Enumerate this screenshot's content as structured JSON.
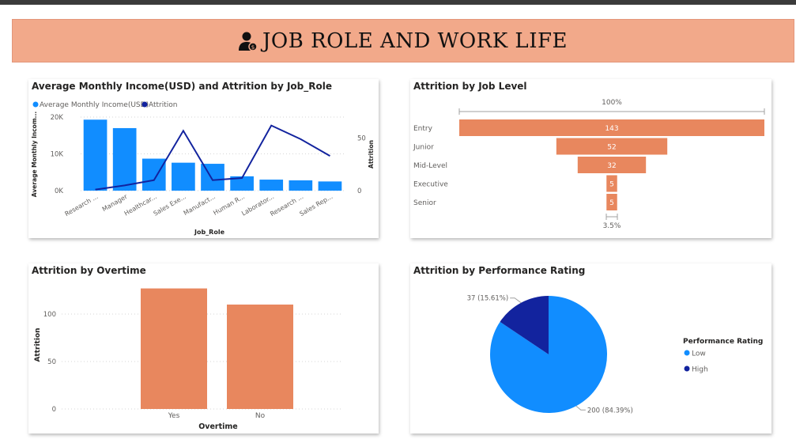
{
  "banner": {
    "title": "JOB ROLE AND WORK LIFE",
    "icon": "person-money-icon"
  },
  "colors": {
    "blue": "#118dff",
    "navy": "#12239e",
    "orange": "#e8875e",
    "banner": "#f2a98a"
  },
  "charts": {
    "income": {
      "title": "Average Monthly Income(USD) and Attrition by Job_Role",
      "legend": [
        "Average Monthly Income(USD)",
        "Attrition"
      ],
      "ylabel": "Average Monthly Incom...",
      "y2label": "Attrition",
      "xlabel": "Job_Role",
      "yticks": [
        "0K",
        "10K",
        "20K"
      ],
      "y2ticks": [
        "0",
        "50"
      ],
      "categories": [
        "Research ...",
        "Manager",
        "Healthcar...",
        "Sales Exe...",
        "Manufact...",
        "Human R...",
        "Laborator...",
        "Research ...",
        "Sales Rep..."
      ]
    },
    "joblevel": {
      "title": "Attrition by Job Level",
      "top_label": "100%",
      "bottom_label": "3.5%"
    },
    "overtime": {
      "title": "Attrition by Overtime",
      "ylabel": "Attrition",
      "xlabel": "Overtime",
      "yticks": [
        "0",
        "50",
        "100"
      ]
    },
    "performance": {
      "title": "Attrition by Performance Rating",
      "legend_title": "Performance Rating",
      "legend": [
        "Low",
        "High"
      ]
    }
  },
  "chart_data": [
    {
      "type": "bar",
      "title": "Average Monthly Income(USD) and Attrition by Job_Role",
      "xlabel": "Job_Role",
      "ylabel": "Average Monthly Income(USD)",
      "y2label": "Attrition",
      "categories": [
        "Research ...",
        "Manager",
        "Healthcar...",
        "Sales Exe...",
        "Manufact...",
        "Human R...",
        "Laborator...",
        "Research ...",
        "Sales Rep..."
      ],
      "ylim": [
        0,
        20000
      ],
      "y2lim": [
        0,
        70
      ],
      "series": [
        {
          "name": "Average Monthly Income(USD)",
          "type": "bar",
          "values": [
            19300,
            17000,
            8700,
            7600,
            7300,
            3900,
            3000,
            2800,
            2500
          ]
        },
        {
          "name": "Attrition",
          "type": "line",
          "axis": "secondary",
          "values": [
            1,
            5,
            10,
            57,
            10,
            12,
            62,
            49,
            33
          ]
        }
      ]
    },
    {
      "type": "bar",
      "orientation": "funnel",
      "title": "Attrition by Job Level",
      "categories": [
        "Entry",
        "Junior",
        "Mid-Level",
        "Executive",
        "Senior"
      ],
      "values": [
        143,
        52,
        32,
        5,
        5
      ]
    },
    {
      "type": "bar",
      "title": "Attrition by Overtime",
      "xlabel": "Overtime",
      "ylabel": "Attrition",
      "categories": [
        "Yes",
        "No"
      ],
      "values": [
        127,
        110
      ],
      "ylim": [
        0,
        140
      ]
    },
    {
      "type": "pie",
      "title": "Attrition by Performance Rating",
      "legend_title": "Performance Rating",
      "categories": [
        "Low",
        "High"
      ],
      "values": [
        200,
        37
      ],
      "labels": [
        "200 (84.39%)",
        "37 (15.61%)"
      ]
    }
  ]
}
